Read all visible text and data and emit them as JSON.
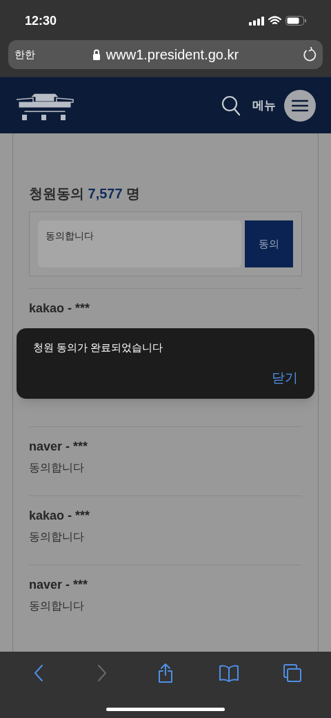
{
  "status_bar": {
    "time": "12:30"
  },
  "browser": {
    "reader_label": "한한",
    "url": "www1.president.go.kr"
  },
  "header": {
    "menu_label": "메뉴"
  },
  "petition": {
    "label": "청원동의",
    "count": "7,577",
    "unit": "명"
  },
  "form": {
    "value": "동의합니다",
    "button": "동의"
  },
  "comments": [
    {
      "author": "kakao - ***"
    },
    {
      "author": "naver - ***",
      "text": "동의합니다"
    },
    {
      "author": "kakao - ***",
      "text": "동의합니다"
    },
    {
      "author": "naver - ***",
      "text": "동의합니다"
    }
  ],
  "toast": {
    "message": "청원 동의가 완료되었습니다",
    "action": "닫기"
  },
  "toolbar": {
    "buttons": [
      {
        "kind": "back",
        "disabled": false
      },
      {
        "kind": "forward",
        "disabled": true
      },
      {
        "kind": "share",
        "disabled": false
      },
      {
        "kind": "bookmarks",
        "disabled": false
      },
      {
        "kind": "tabs",
        "disabled": false
      }
    ]
  }
}
